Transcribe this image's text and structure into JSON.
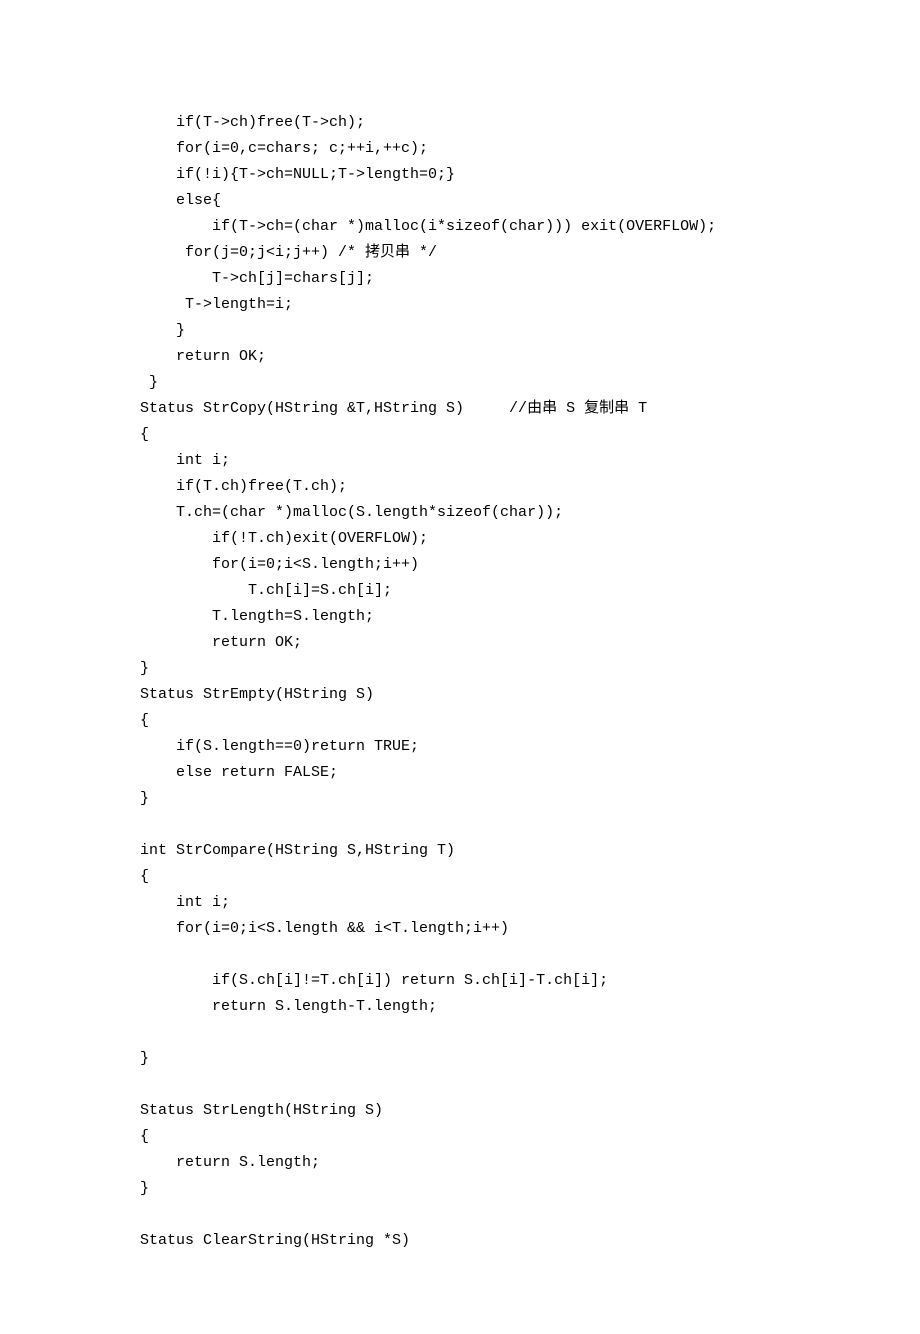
{
  "lines": [
    {
      "indent": "    ",
      "text": "if(T->ch)free(T->ch);"
    },
    {
      "indent": "    ",
      "text": "for(i=0,c=chars; c;++i,++c);"
    },
    {
      "indent": "    ",
      "text": "if(!i){T->ch=NULL;T->length=0;}"
    },
    {
      "indent": "    ",
      "text": "else{"
    },
    {
      "indent": "        ",
      "text": "if(T->ch=(char *)malloc(i*sizeof(char))) exit(OVERFLOW);"
    },
    {
      "indent": "     ",
      "text": "for(j=0;j<i;j++) /* 拷贝串 */"
    },
    {
      "indent": "        ",
      "text": "T->ch[j]=chars[j];"
    },
    {
      "indent": "     ",
      "text": "T->length=i;"
    },
    {
      "indent": "    ",
      "text": "}"
    },
    {
      "indent": "    ",
      "text": "return OK;"
    },
    {
      "indent": " ",
      "text": "}"
    },
    {
      "indent": "",
      "text": "Status StrCopy(HString &T,HString S)     //由串 S 复制串 T"
    },
    {
      "indent": "",
      "text": "{"
    },
    {
      "indent": "    ",
      "text": "int i;"
    },
    {
      "indent": "    ",
      "text": "if(T.ch)free(T.ch);"
    },
    {
      "indent": "    ",
      "text": "T.ch=(char *)malloc(S.length*sizeof(char));"
    },
    {
      "indent": "        ",
      "text": "if(!T.ch)exit(OVERFLOW);"
    },
    {
      "indent": "        ",
      "text": "for(i=0;i<S.length;i++)"
    },
    {
      "indent": "            ",
      "text": "T.ch[i]=S.ch[i];"
    },
    {
      "indent": "        ",
      "text": "T.length=S.length;"
    },
    {
      "indent": "        ",
      "text": "return OK;"
    },
    {
      "indent": "",
      "text": "}"
    },
    {
      "indent": "",
      "text": "Status StrEmpty(HString S)"
    },
    {
      "indent": "",
      "text": "{"
    },
    {
      "indent": "    ",
      "text": "if(S.length==0)return TRUE;"
    },
    {
      "indent": "    ",
      "text": "else return FALSE;"
    },
    {
      "indent": "",
      "text": "}"
    },
    {
      "blank": true
    },
    {
      "indent": "",
      "text": "int StrCompare(HString S,HString T)"
    },
    {
      "indent": "",
      "text": "{"
    },
    {
      "indent": "    ",
      "text": "int i;"
    },
    {
      "indent": "    ",
      "text": "for(i=0;i<S.length && i<T.length;i++)"
    },
    {
      "blank": true
    },
    {
      "indent": "        ",
      "text": "if(S.ch[i]!=T.ch[i]) return S.ch[i]-T.ch[i];"
    },
    {
      "indent": "        ",
      "text": "return S.length-T.length;"
    },
    {
      "blank": true
    },
    {
      "indent": "",
      "text": "}"
    },
    {
      "blank": true
    },
    {
      "indent": "",
      "text": "Status StrLength(HString S)"
    },
    {
      "indent": "",
      "text": "{"
    },
    {
      "indent": "    ",
      "text": "return S.length;"
    },
    {
      "indent": "",
      "text": "}"
    },
    {
      "blank": true
    },
    {
      "indent": "",
      "text": "Status ClearString(HString *S)"
    }
  ]
}
